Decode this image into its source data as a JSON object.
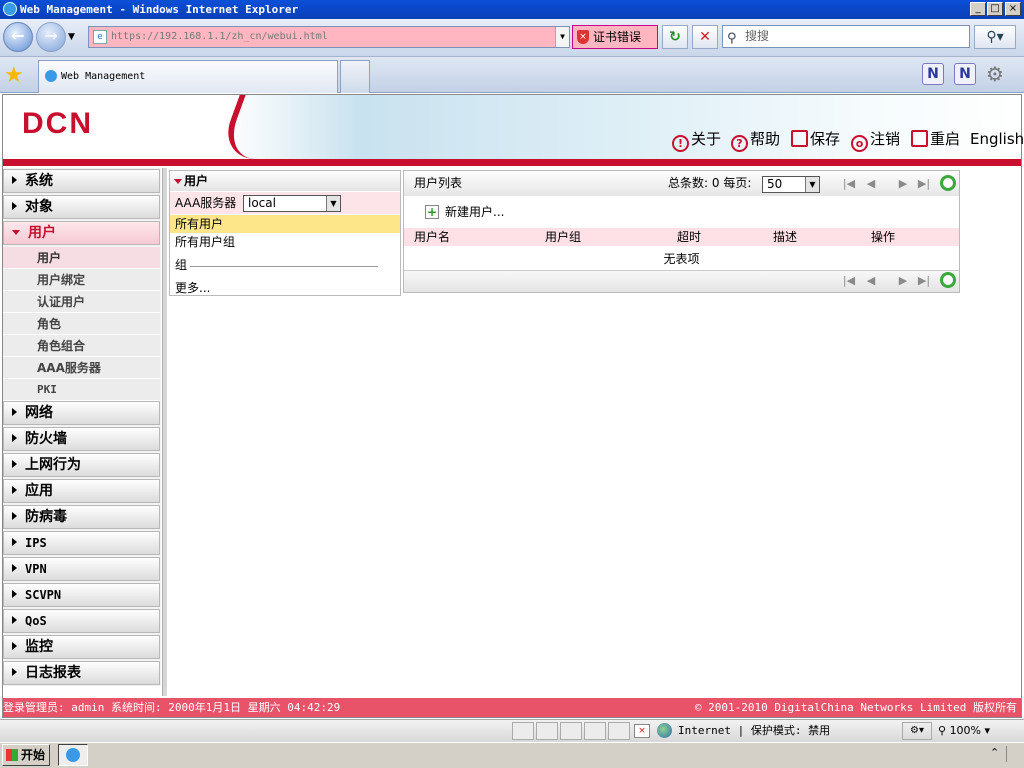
{
  "window": {
    "title": "Web Management - Windows Internet Explorer",
    "minimize": "_",
    "maximize": "□",
    "close": "×"
  },
  "browser": {
    "address": "https://192.168.1.1/zh_cn/webui.html",
    "cert_error": "证书错误",
    "search_placeholder": "搜搜",
    "tab_title": "Web Management"
  },
  "header": {
    "logo": "DCN",
    "links": {
      "about": "关于",
      "help": "帮助",
      "save": "保存",
      "logout": "注销",
      "reboot": "重启",
      "english": "English"
    }
  },
  "sidebar": {
    "menus": {
      "system": "系统",
      "object": "对象",
      "user": "用户",
      "network": "网络",
      "firewall": "防火墙",
      "internet_behavior": "上网行为",
      "application": "应用",
      "antivirus": "防病毒",
      "ips": "IPS",
      "vpn": "VPN",
      "scvpn": "SCVPN",
      "qos": "QoS",
      "monitor": "监控",
      "log_report": "日志报表"
    },
    "user_submenu": {
      "user": "用户",
      "user_binding": "用户绑定",
      "auth_user": "认证用户",
      "role": "角色",
      "role_combination": "角色组合",
      "aaa_server": "AAA服务器",
      "pki": "PKI"
    }
  },
  "user_panel": {
    "title": "用户",
    "aaa_label": "AAA服务器",
    "aaa_value": "local",
    "all_users": "所有用户",
    "all_user_groups": "所有用户组",
    "group_label": "组",
    "more": "更多..."
  },
  "user_list": {
    "title": "用户列表",
    "total_label": "总条数:",
    "total_value": "0",
    "per_page_label": "每页:",
    "per_page_value": "50",
    "new_user": "新建用户...",
    "columns": {
      "username": "用户名",
      "user_group": "用户组",
      "timeout": "超时",
      "description": "描述",
      "operation": "操作"
    },
    "empty_text": "无表项"
  },
  "page_status": {
    "left": "登录管理员: admin 系统时间: 2000年1月1日 星期六 04:42:29",
    "right": "© 2001-2010 DigitalChina Networks Limited 版权所有"
  },
  "ie_status": {
    "zone": "Internet",
    "protected_mode": "| 保护模式: 禁用",
    "zoom": "100%"
  },
  "taskbar": {
    "start": "开始"
  },
  "colors": {
    "brand_red": "#c8102e",
    "address_error": "#ffb6c1",
    "selected_row": "#fde68a"
  }
}
